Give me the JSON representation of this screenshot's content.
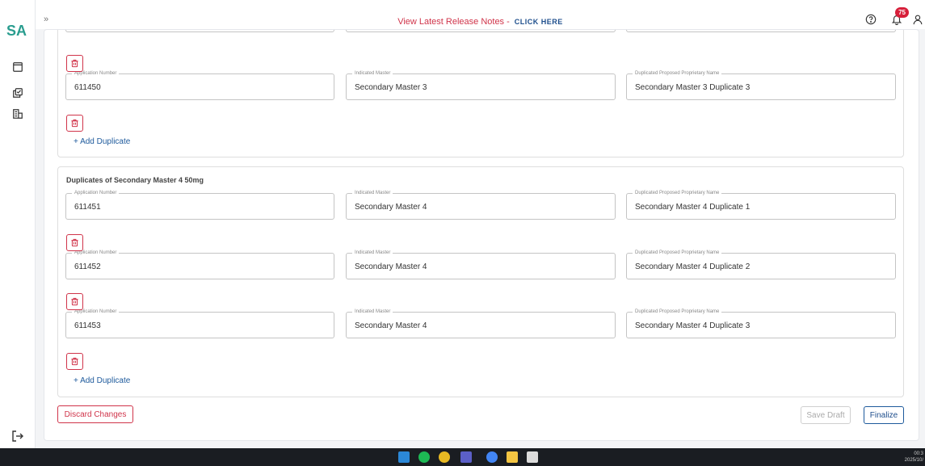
{
  "app": {
    "logo": "SA"
  },
  "topbar": {
    "expand_glyph": "»",
    "release_notes": "View Latest Release Notes -",
    "click_here": "CLICK HERE",
    "notification_count": "75"
  },
  "icons": {
    "help": "help-circle-icon",
    "bell": "bell-icon",
    "user": "user-icon",
    "sidebar": [
      "window-icon",
      "copy-check-icon",
      "building-icon"
    ],
    "logout": "logout-icon",
    "delete": "trash-icon"
  },
  "labels": {
    "application_number": "Application Number",
    "indicated_master": "Indicated Master",
    "duplicated_name": "Duplicated Proposed Proprietary Name",
    "add_duplicate": "+ Add Duplicate"
  },
  "groups": [
    {
      "title": "",
      "rows": [
        {
          "application_number": "611450",
          "indicated_master": "Secondary Master 3",
          "duplicated_name": "Secondary Master 3 Duplicate 3"
        }
      ]
    },
    {
      "title": "Duplicates of Secondary Master 4 50mg",
      "rows": [
        {
          "application_number": "611451",
          "indicated_master": "Secondary Master 4",
          "duplicated_name": "Secondary Master 4 Duplicate 1"
        },
        {
          "application_number": "611452",
          "indicated_master": "Secondary Master 4",
          "duplicated_name": "Secondary Master 4 Duplicate 2"
        },
        {
          "application_number": "611453",
          "indicated_master": "Secondary Master 4",
          "duplicated_name": "Secondary Master 4 Duplicate 3"
        }
      ]
    }
  ],
  "actions": {
    "discard": "Discard Changes",
    "save_draft": "Save Draft",
    "finalize": "Finalize"
  },
  "taskbar": {
    "time": "00:3",
    "date": "2025/10/"
  },
  "colors": {
    "accent_red": "#d0344a",
    "accent_blue": "#1e4e8c",
    "logo_teal": "#2a9d8f",
    "badge_red": "#d71f3a"
  }
}
